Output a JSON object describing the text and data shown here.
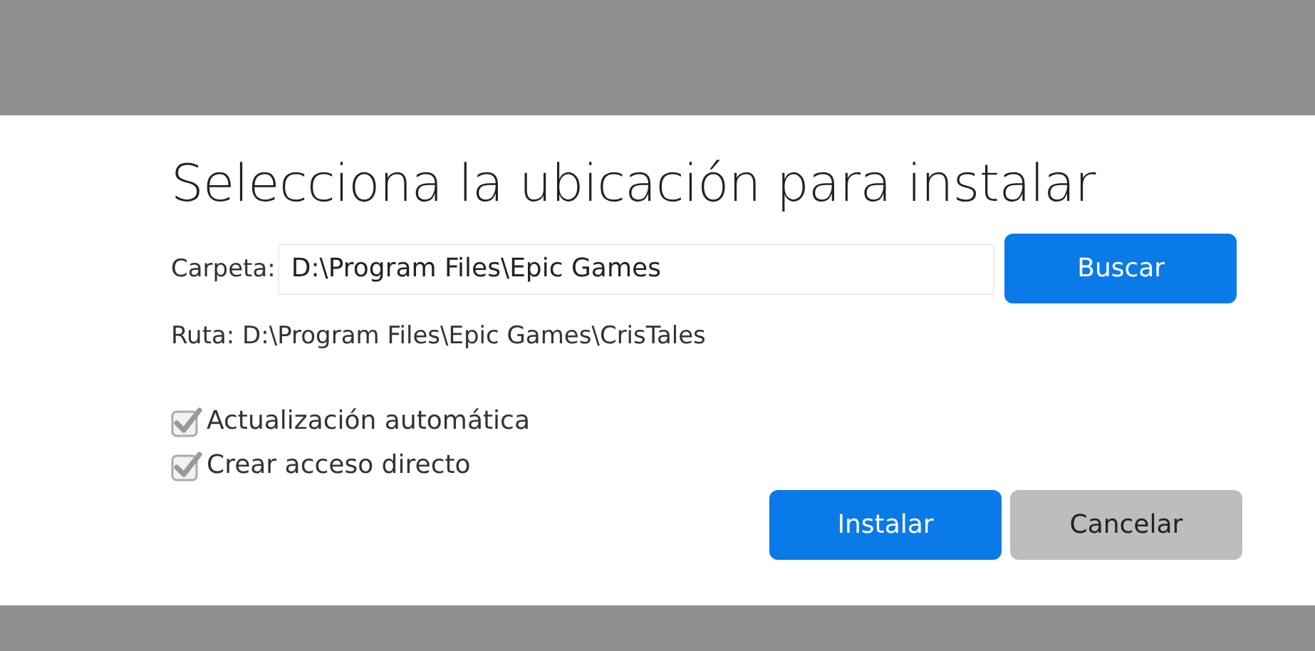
{
  "title": "Selecciona la ubicación para instalar",
  "folder": {
    "label": "Carpeta:",
    "value": "D:\\Program Files\\Epic Games",
    "browse_button": "Buscar"
  },
  "path": "Ruta: D:\\Program Files\\Epic Games\\CrisTales",
  "options": [
    {
      "label": "Actualización automática",
      "checked": true
    },
    {
      "label": "Crear acceso directo",
      "checked": true
    }
  ],
  "buttons": [
    {
      "label": "Instalar",
      "kind": "primary"
    },
    {
      "label": "Cancelar",
      "kind": "secondary"
    }
  ]
}
